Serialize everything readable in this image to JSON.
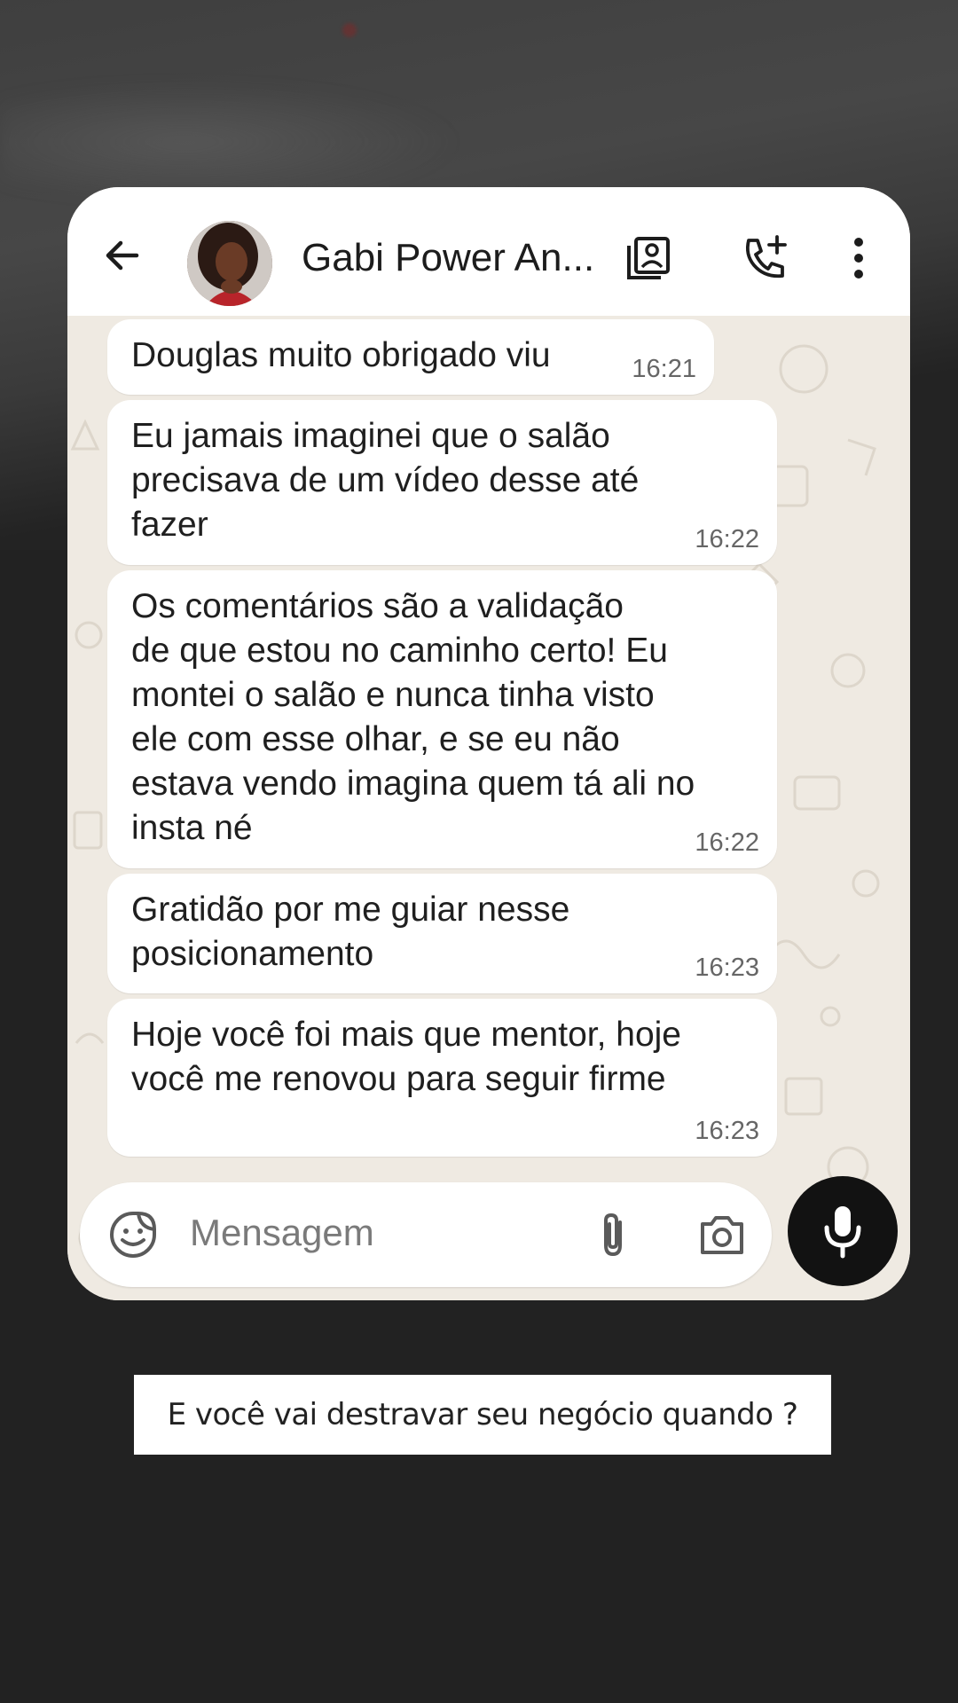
{
  "header": {
    "contact_name": "Gabi Power An...",
    "icons": [
      "arrow-left-icon",
      "avatar",
      "contact-card-icon",
      "add-call-icon",
      "more-vertical-icon"
    ]
  },
  "messages": [
    {
      "text": "Douglas muito obrigado viu",
      "time": "16:21"
    },
    {
      "text": "Eu jamais imaginei que o salão\nprecisava de um vídeo desse até\nfazer",
      "time": "16:22"
    },
    {
      "text": "Os comentários são a validação\nde que estou no caminho certo! Eu\nmontei o salão e nunca tinha visto\nele com esse olhar, e se eu não\nestava vendo imagina quem tá ali no\ninsta né",
      "time": "16:22"
    },
    {
      "text": "Gratidão por me guiar nesse\nposicionamento",
      "time": "16:23"
    },
    {
      "text": "Hoje você foi mais que mentor, hoje\nvocê me renovou para seguir firme",
      "time": "16:23"
    }
  ],
  "composer": {
    "placeholder": "Mensagem",
    "icons": [
      "sticker-icon",
      "attach-icon",
      "camera-icon",
      "mic-icon"
    ]
  },
  "caption": "E você vai destravar seu negócio quando ?",
  "colors": {
    "page_background": "#222222",
    "chat_background": "#efeae2",
    "bubble": "#ffffff",
    "mic_button": "#121212"
  }
}
